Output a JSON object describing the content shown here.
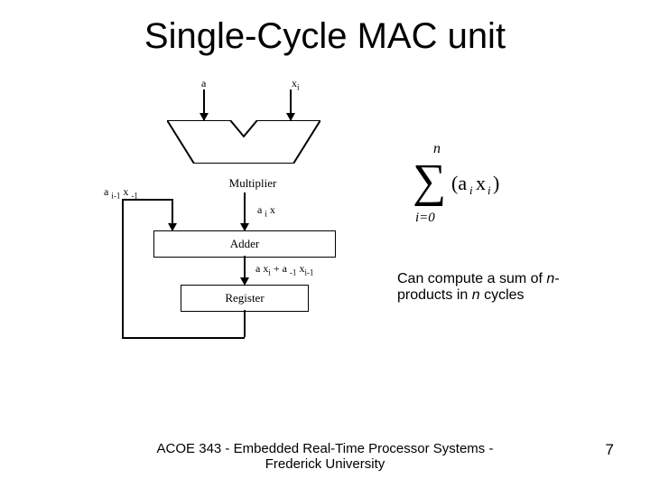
{
  "title": "Single-Cycle MAC unit",
  "diagram": {
    "input_a": "a",
    "input_x_base": "x",
    "input_x_sub": "i",
    "multiplier_label": "Multiplier",
    "feedback_label_html": "a <sub>i-1</sub> x <sub>-1</sub>",
    "mult_out_html": "a <sub>i</sub> x",
    "adder_label": "Adder",
    "adder_out_html": "a x<sub>i</sub> + a <sub>-1</sub> x<sub>i-1</sub>",
    "register_label": "Register"
  },
  "formula": {
    "upper": "n",
    "body_html": "(a<sub>i</sub> x<sub>i</sub>)",
    "lower": "i=0"
  },
  "caption_pre": "Can compute a sum of ",
  "caption_n": "n",
  "caption_mid": "-products in ",
  "caption_n2": "n",
  "caption_post": " cycles",
  "footer": "ACOE 343 - Embedded Real-Time Processor Systems - Frederick University",
  "page": "7"
}
